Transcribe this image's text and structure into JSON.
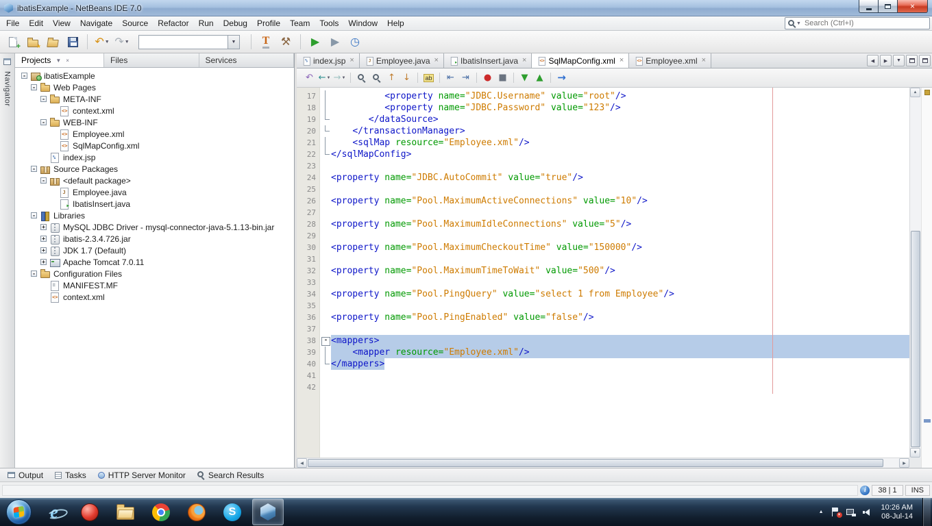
{
  "colors": {
    "tag": "#0d15c8",
    "attr": "#009900",
    "value": "#ce7b00",
    "selection": "#b6cce8",
    "margin_line": "#e39a9a"
  },
  "window": {
    "title": "ibatisExample - NetBeans IDE 7.0"
  },
  "menubar": {
    "items": [
      "File",
      "Edit",
      "View",
      "Navigate",
      "Source",
      "Refactor",
      "Run",
      "Debug",
      "Profile",
      "Team",
      "Tools",
      "Window",
      "Help"
    ],
    "search_placeholder": "Search (Ctrl+I)"
  },
  "toolbar": {
    "items": [
      "new-file",
      "new-project",
      "open-project",
      "save-all",
      "separator",
      "undo",
      "redo",
      "memory-combo",
      "separator",
      "web-tool",
      "build-project",
      "separator",
      "run-project",
      "debug-project",
      "profile-project"
    ]
  },
  "navigator_strip": {
    "label": "Navigator"
  },
  "explorer": {
    "tabs": [
      {
        "label": "Projects",
        "active": true
      },
      {
        "label": "Files",
        "active": false
      },
      {
        "label": "Services",
        "active": false
      }
    ],
    "tree": [
      {
        "indent": 0,
        "expander": "-",
        "icon": "project",
        "label": "ibatisExample"
      },
      {
        "indent": 1,
        "expander": "-",
        "icon": "folder-web",
        "label": "Web Pages"
      },
      {
        "indent": 2,
        "expander": "-",
        "icon": "folder",
        "label": "META-INF"
      },
      {
        "indent": 3,
        "expander": "",
        "icon": "xml",
        "label": "context.xml"
      },
      {
        "indent": 2,
        "expander": "-",
        "icon": "folder",
        "label": "WEB-INF"
      },
      {
        "indent": 3,
        "expander": "",
        "icon": "xml",
        "label": "Employee.xml"
      },
      {
        "indent": 3,
        "expander": "",
        "icon": "xml",
        "label": "SqlMapConfig.xml"
      },
      {
        "indent": 2,
        "expander": "",
        "icon": "jsp",
        "label": "index.jsp"
      },
      {
        "indent": 1,
        "expander": "-",
        "icon": "pkg-root",
        "label": "Source Packages"
      },
      {
        "indent": 2,
        "expander": "-",
        "icon": "pkg",
        "label": "<default package>"
      },
      {
        "indent": 3,
        "expander": "",
        "icon": "java",
        "label": "Employee.java"
      },
      {
        "indent": 3,
        "expander": "",
        "icon": "java-main",
        "label": "IbatisInsert.java"
      },
      {
        "indent": 1,
        "expander": "-",
        "icon": "libs",
        "label": "Libraries"
      },
      {
        "indent": 2,
        "expander": "+",
        "icon": "jar",
        "label": "MySQL JDBC Driver - mysql-connector-java-5.1.13-bin.jar"
      },
      {
        "indent": 2,
        "expander": "+",
        "icon": "jar",
        "label": "ibatis-2.3.4.726.jar"
      },
      {
        "indent": 2,
        "expander": "+",
        "icon": "jdk",
        "label": "JDK 1.7 (Default)"
      },
      {
        "indent": 2,
        "expander": "+",
        "icon": "server",
        "label": "Apache Tomcat 7.0.11"
      },
      {
        "indent": 1,
        "expander": "-",
        "icon": "folder-config",
        "label": "Configuration Files"
      },
      {
        "indent": 2,
        "expander": "",
        "icon": "manifest",
        "label": "MANIFEST.MF"
      },
      {
        "indent": 2,
        "expander": "",
        "icon": "xml",
        "label": "context.xml"
      }
    ]
  },
  "editor": {
    "tabs": [
      {
        "label": "index.jsp",
        "icon": "jsp",
        "active": false
      },
      {
        "label": "Employee.java",
        "icon": "java",
        "active": false
      },
      {
        "label": "IbatisInsert.java",
        "icon": "java-main",
        "active": false
      },
      {
        "label": "SqlMapConfig.xml",
        "icon": "xml",
        "active": true
      },
      {
        "label": "Employee.xml",
        "icon": "xml",
        "active": false
      }
    ],
    "toolbar_icons": [
      "last-edited",
      "back",
      "forward",
      "separator",
      "find",
      "find-selection",
      "previous-occurrence",
      "next-occurrence",
      "separator",
      "toggle-highlight-search",
      "separator",
      "shift-line-left",
      "shift-line-right",
      "separator",
      "start-macro-recording",
      "stop-macro-recording",
      "separator",
      "collapse-all-folds",
      "expand-all-folds",
      "separator",
      "run-to-cursor"
    ],
    "code_lines": [
      {
        "n": 17,
        "fold": "v",
        "seg": [
          [
            "          ",
            "p"
          ],
          [
            "<property",
            "t"
          ],
          [
            " ",
            "p"
          ],
          [
            "name=",
            "a"
          ],
          [
            "\"JDBC.Username\"",
            "v"
          ],
          [
            " ",
            "p"
          ],
          [
            "value=",
            "a"
          ],
          [
            "\"root\"",
            "v"
          ],
          [
            "/>",
            "t"
          ]
        ]
      },
      {
        "n": 18,
        "fold": "v",
        "seg": [
          [
            "          ",
            "p"
          ],
          [
            "<property",
            "t"
          ],
          [
            " ",
            "p"
          ],
          [
            "name=",
            "a"
          ],
          [
            "\"JDBC.Password\"",
            "v"
          ],
          [
            " ",
            "p"
          ],
          [
            "value=",
            "a"
          ],
          [
            "\"123\"",
            "v"
          ],
          [
            "/>",
            "t"
          ]
        ]
      },
      {
        "n": 19,
        "fold": "end",
        "seg": [
          [
            "       ",
            "p"
          ],
          [
            "</dataSource>",
            "t"
          ]
        ]
      },
      {
        "n": 20,
        "fold": "end",
        "seg": [
          [
            "    ",
            "p"
          ],
          [
            "</transactionManager>",
            "t"
          ]
        ]
      },
      {
        "n": 21,
        "fold": "v",
        "seg": [
          [
            "    ",
            "p"
          ],
          [
            "<sqlMap",
            "t"
          ],
          [
            " ",
            "p"
          ],
          [
            "resource=",
            "a"
          ],
          [
            "\"Employee.xml\"",
            "v"
          ],
          [
            "/>",
            "t"
          ]
        ]
      },
      {
        "n": 22,
        "fold": "end",
        "seg": [
          [
            "</sqlMapConfig>",
            "t"
          ]
        ]
      },
      {
        "n": 23,
        "seg": []
      },
      {
        "n": 24,
        "seg": [
          [
            "<property",
            "t"
          ],
          [
            " ",
            "p"
          ],
          [
            "name=",
            "a"
          ],
          [
            "\"JDBC.AutoCommit\"",
            "v"
          ],
          [
            " ",
            "p"
          ],
          [
            "value=",
            "a"
          ],
          [
            "\"true\"",
            "v"
          ],
          [
            "/>",
            "t"
          ]
        ]
      },
      {
        "n": 25,
        "seg": []
      },
      {
        "n": 26,
        "seg": [
          [
            "<property",
            "t"
          ],
          [
            " ",
            "p"
          ],
          [
            "name=",
            "a"
          ],
          [
            "\"Pool.MaximumActiveConnections\"",
            "v"
          ],
          [
            " ",
            "p"
          ],
          [
            "value=",
            "a"
          ],
          [
            "\"10\"",
            "v"
          ],
          [
            "/>",
            "t"
          ]
        ]
      },
      {
        "n": 27,
        "seg": []
      },
      {
        "n": 28,
        "seg": [
          [
            "<property",
            "t"
          ],
          [
            " ",
            "p"
          ],
          [
            "name=",
            "a"
          ],
          [
            "\"Pool.MaximumIdleConnections\"",
            "v"
          ],
          [
            " ",
            "p"
          ],
          [
            "value=",
            "a"
          ],
          [
            "\"5\"",
            "v"
          ],
          [
            "/>",
            "t"
          ]
        ]
      },
      {
        "n": 29,
        "seg": []
      },
      {
        "n": 30,
        "seg": [
          [
            "<property",
            "t"
          ],
          [
            " ",
            "p"
          ],
          [
            "name=",
            "a"
          ],
          [
            "\"Pool.MaximumCheckoutTime\"",
            "v"
          ],
          [
            " ",
            "p"
          ],
          [
            "value=",
            "a"
          ],
          [
            "\"150000\"",
            "v"
          ],
          [
            "/>",
            "t"
          ]
        ]
      },
      {
        "n": 31,
        "seg": []
      },
      {
        "n": 32,
        "seg": [
          [
            "<property",
            "t"
          ],
          [
            " ",
            "p"
          ],
          [
            "name=",
            "a"
          ],
          [
            "\"Pool.MaximumTimeToWait\"",
            "v"
          ],
          [
            " ",
            "p"
          ],
          [
            "value=",
            "a"
          ],
          [
            "\"500\"",
            "v"
          ],
          [
            "/>",
            "t"
          ]
        ]
      },
      {
        "n": 33,
        "seg": []
      },
      {
        "n": 34,
        "seg": [
          [
            "<property",
            "t"
          ],
          [
            " ",
            "p"
          ],
          [
            "name=",
            "a"
          ],
          [
            "\"Pool.PingQuery\"",
            "v"
          ],
          [
            " ",
            "p"
          ],
          [
            "value=",
            "a"
          ],
          [
            "\"select 1 from Employee\"",
            "v"
          ],
          [
            "/>",
            "t"
          ]
        ]
      },
      {
        "n": 35,
        "seg": []
      },
      {
        "n": 36,
        "seg": [
          [
            "<property",
            "t"
          ],
          [
            " ",
            "p"
          ],
          [
            "name=",
            "a"
          ],
          [
            "\"Pool.PingEnabled\"",
            "v"
          ],
          [
            " ",
            "p"
          ],
          [
            "value=",
            "a"
          ],
          [
            "\"false\"",
            "v"
          ],
          [
            "/>",
            "t"
          ]
        ]
      },
      {
        "n": 37,
        "seg": []
      },
      {
        "n": 38,
        "fold": "box",
        "sel": "full",
        "seg": [
          [
            "<mappers>",
            "t"
          ]
        ]
      },
      {
        "n": 39,
        "fold": "v",
        "sel": "full",
        "seg": [
          [
            "    ",
            "p"
          ],
          [
            "<mapper",
            "t"
          ],
          [
            " ",
            "p"
          ],
          [
            "resource=",
            "a"
          ],
          [
            "\"Employee.xml\"",
            "v"
          ],
          [
            "/>",
            "t"
          ]
        ]
      },
      {
        "n": 40,
        "fold": "end",
        "sel": "text",
        "seg": [
          [
            "</mappers>",
            "t"
          ]
        ]
      },
      {
        "n": 41,
        "seg": []
      },
      {
        "n": 42,
        "seg": []
      }
    ]
  },
  "bottom_tabs": [
    {
      "label": "Output",
      "icon": "output-window-icon"
    },
    {
      "label": "Tasks",
      "icon": "tasks-icon"
    },
    {
      "label": "HTTP Server Monitor",
      "icon": "http-monitor-icon"
    },
    {
      "label": "Search Results",
      "icon": "search-icon"
    }
  ],
  "statusbar": {
    "caret_position": "38 | 1",
    "typing_mode": "INS"
  },
  "taskbar": {
    "apps": [
      {
        "name": "start-button",
        "active": false
      },
      {
        "name": "internet-explorer",
        "active": false
      },
      {
        "name": "red-circle-app",
        "active": false
      },
      {
        "name": "windows-explorer",
        "active": false
      },
      {
        "name": "chrome",
        "active": false
      },
      {
        "name": "firefox",
        "active": false
      },
      {
        "name": "skype",
        "active": false
      },
      {
        "name": "netbeans",
        "active": true
      }
    ],
    "tray_icons": [
      "show-hidden-icons",
      "action-center",
      "network",
      "volume"
    ],
    "clock_time": "10:26 AM",
    "clock_date": "08-Jul-14"
  }
}
